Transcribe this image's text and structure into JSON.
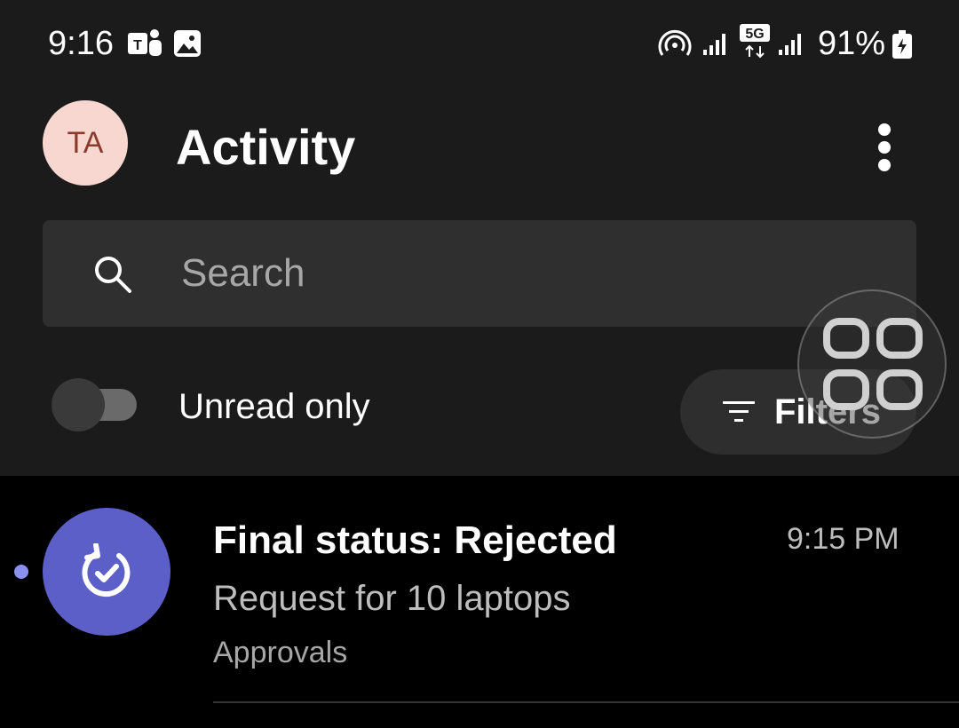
{
  "status_bar": {
    "time": "9:16",
    "network": "5G",
    "battery": "91%",
    "icons": [
      "teams-icon",
      "gallery-icon",
      "hotspot-icon",
      "signal-icon",
      "5g-icon",
      "signal-icon",
      "battery-charging-icon"
    ]
  },
  "header": {
    "avatar_initials": "TA",
    "title": "Activity",
    "more_icon": "more-vertical-icon"
  },
  "search": {
    "placeholder": "Search"
  },
  "filters": {
    "unread_label": "Unread only",
    "unread_on": false,
    "filters_label": "Filters"
  },
  "activity": [
    {
      "title": "Final status: Rejected",
      "time": "9:15 PM",
      "subtitle": "Request for 10 laptops",
      "app": "Approvals",
      "unread": true,
      "icon": "approvals-icon"
    }
  ],
  "colors": {
    "background": "#1b1b1b",
    "list_background": "#000000",
    "accent": "#5b5fc7",
    "avatar_bg": "#f7d7d0",
    "unread_dot": "#8b8ff0"
  }
}
